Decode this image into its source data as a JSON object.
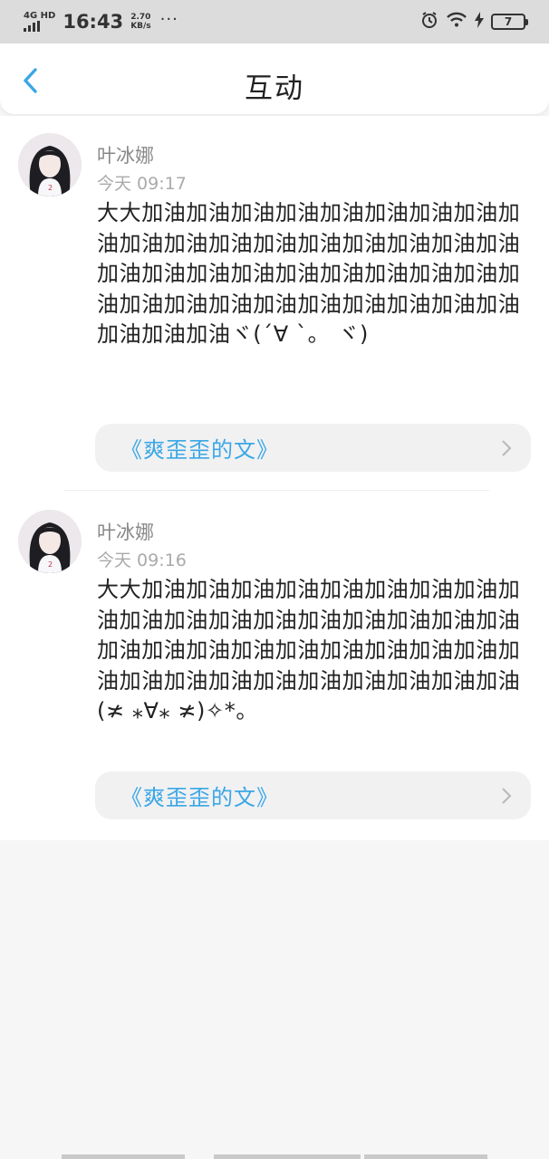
{
  "status_bar": {
    "network": "4G HD",
    "time": "16:43",
    "speed_value": "2.70",
    "speed_unit": "KB/s",
    "more": "···",
    "battery": "7"
  },
  "header": {
    "title": "互动",
    "back_icon": "chevron-left-icon"
  },
  "comments": [
    {
      "username": "叶冰娜",
      "time": "今天 09:17",
      "content": "大大加油加油加油加油加油加油加油加油加油加油加油加油加油加油加油加油加油加油加油加油加油加油加油加油加油加油加油加油加油加油加油加油加油加油加油加油加油加油加油加油ヾ(´∀ ˋ。 ヾ)",
      "source": "《爽歪歪的文》"
    },
    {
      "username": "叶冰娜",
      "time": "今天 09:16",
      "content": "大大加油加油加油加油加油加油加油加油加油加油加油加油加油加油加油加油加油加油加油加油加油加油加油加油加油加油加油加油加油加油加油加油加油加油加油加油加油(≭ ⁎∀⁎ ≭)✧*。",
      "source": "《爽歪歪的文》"
    }
  ],
  "colors": {
    "accent": "#3aa7e6",
    "background": "#f7f6f7",
    "card": "#f1f1f2"
  }
}
